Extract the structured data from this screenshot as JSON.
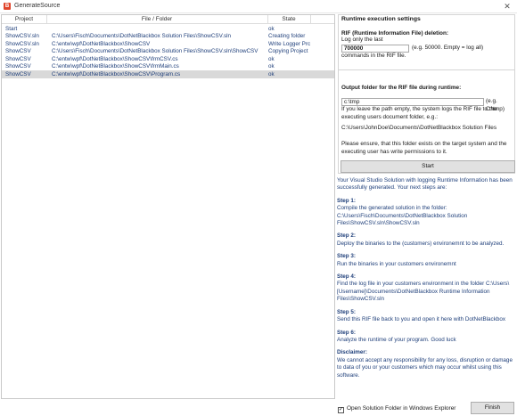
{
  "window": {
    "title": "GenerateSource",
    "icon": "app-icon",
    "close_glyph": "✕"
  },
  "table": {
    "columns": [
      "Project",
      "File / Folder",
      "State"
    ],
    "rows": [
      {
        "project": "Start",
        "file": "",
        "state": "ok"
      },
      {
        "project": "ShowCSV.sln",
        "file": "C:\\Users\\Fisch\\Documents\\DotNetBlackbox Solution Files\\ShowCSV.sln",
        "state": "Creating folder"
      },
      {
        "project": "ShowCSV.sln",
        "file": "C:\\entw\\wpf\\DotNetBlackbox\\ShowCSV",
        "state": "Write Logger Prc"
      },
      {
        "project": "ShowCSV",
        "file": "C:\\Users\\Fisch\\Documents\\DotNetBlackbox Solution Files\\ShowCSV.sln\\ShowCSV",
        "state": "Copying Project"
      },
      {
        "project": "ShowCSV",
        "file": "C:\\entw\\wpf\\DotNetBlackbox\\ShowCSV\\frmCSV.cs",
        "state": "ok"
      },
      {
        "project": "ShowCSV",
        "file": "C:\\entw\\wpf\\DotNetBlackbox\\ShowCSV\\frmMain.cs",
        "state": "ok"
      },
      {
        "project": "ShowCSV",
        "file": "C:\\entw\\wpf\\DotNetBlackbox\\ShowCSV\\Program.cs",
        "state": "ok"
      }
    ]
  },
  "settings": {
    "heading": "Runtime execution settings",
    "rif_heading": "RIF (Runtime Information File) deletion:",
    "log_only_label": "Log only the last",
    "log_value": "700000",
    "log_hint": "(e.g. 50000. Empty = log all)",
    "log_suffix": "commands in the RIF file.",
    "output_heading": "Output folder for the RIF file during runtime:",
    "output_value": "c:\\tmp",
    "output_hint": "(e.g. C:\\tmp)",
    "output_desc": "If you leave the path empty, the system logs the RIF file to the executing users document folder, e.g.:",
    "example_path": "C:\\Users\\JohnDoe\\Documents\\DotNetBlackbox Solution Files",
    "ensure_text": "Please ensure, that this folder exists on the target system and the executing user has write permissions to it.",
    "start_label": "Start"
  },
  "instructions": {
    "intro": "Your Visual Studio Solution with logging Runtime Information has been successfully generated. Your next steps are:",
    "steps": [
      {
        "title": "Step 1:",
        "text": "Compile the generated solution in the folder: C:\\Users\\Fisch\\Documents\\DotNetBlackbox Solution Files\\ShowCSV.sln\\ShowCSV.sln"
      },
      {
        "title": "Step 2:",
        "text": "Deploy the binaries to the (customers) environemnt to be analyzed."
      },
      {
        "title": "Step 3:",
        "text": "Run the binaries in your customers environemnt"
      },
      {
        "title": "Step 4:",
        "text": "Find the log file in your customers environment in the folder C:\\Users\\[Username]\\Documents\\DotNetBlackbox Runtime Information Files\\ShowCSV.sln"
      },
      {
        "title": "Step 5:",
        "text": "Send this RIF file back to you and open it here with DotNetBlackbox"
      },
      {
        "title": "Step 6:",
        "text": "Analyze the runtime of your program. Good luck"
      }
    ],
    "disclaimer_title": "Disclaimer:",
    "disclaimer_text": "We cannot accept any responsibility for any loss, disruption or damage to data of you or your customers which may occur whilst using this software."
  },
  "footer": {
    "open_folder_label": "Open Solution Folder in Windows Explorer",
    "open_folder_checked": true,
    "check_glyph": "✓",
    "finish_label": "Finish"
  }
}
